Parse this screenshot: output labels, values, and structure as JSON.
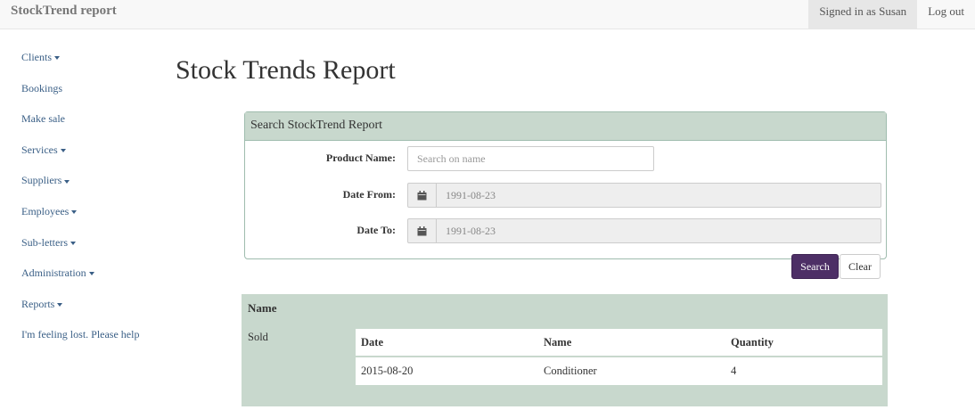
{
  "navbar": {
    "brand": "StockTrend report",
    "signed_in": "Signed in as Susan",
    "logout": "Log out"
  },
  "sidebar": {
    "items": [
      {
        "label": "Clients",
        "dropdown": true
      },
      {
        "label": "Bookings",
        "dropdown": false
      },
      {
        "label": "Make sale",
        "dropdown": false
      },
      {
        "label": "Services",
        "dropdown": true
      },
      {
        "label": "Suppliers",
        "dropdown": true
      },
      {
        "label": "Employees",
        "dropdown": true
      },
      {
        "label": "Sub-letters",
        "dropdown": true
      },
      {
        "label": "Administration",
        "dropdown": true
      },
      {
        "label": "Reports",
        "dropdown": true
      },
      {
        "label": "I'm feeling lost. Please help",
        "dropdown": false
      }
    ]
  },
  "page": {
    "title": "Stock Trends Report"
  },
  "search_panel": {
    "heading": "Search StockTrend Report",
    "product_label": "Product Name:",
    "product_placeholder": "Search on name",
    "date_from_label": "Date From:",
    "date_from_value": "1991-08-23",
    "date_to_label": "Date To:",
    "date_to_value": "1991-08-23",
    "search_button": "Search",
    "clear_button": "Clear"
  },
  "results": {
    "name_header": "Name",
    "row_label": "Sold",
    "columns": [
      "Date",
      "Name",
      "Quantity"
    ],
    "rows": [
      [
        "2015-08-20",
        "Conditioner",
        "4"
      ]
    ]
  },
  "colors": {
    "panel_green": "#c8d8cd",
    "search_purple": "#4d2f66",
    "link_blue": "#3a5f86"
  },
  "icons": {
    "date_addon": "calendar-icon",
    "dropdown": "caret-down-icon"
  }
}
